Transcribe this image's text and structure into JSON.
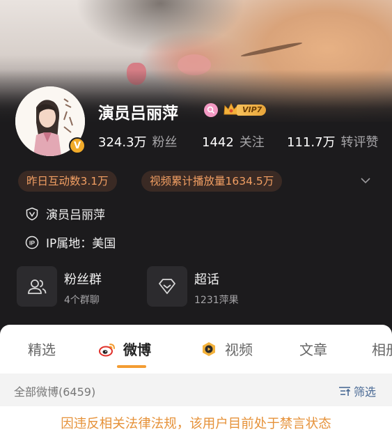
{
  "profile": {
    "name": "演员吕丽萍",
    "vip_label": "VIP7",
    "verified_mark": "V"
  },
  "stats": [
    {
      "num": "324.3万",
      "label": "粉丝"
    },
    {
      "num": "1442",
      "label": "关注"
    },
    {
      "num": "111.7万",
      "label": "转评赞"
    }
  ],
  "chips": {
    "interaction": "昨日互动数3.1万",
    "video_plays": "视频累计播放量1634.5万"
  },
  "info": {
    "certification": "演员吕丽萍",
    "ip_location": "IP属地：美国"
  },
  "cards": [
    {
      "title": "粉丝群",
      "subtitle": "4个群聊"
    },
    {
      "title": "超话",
      "subtitle": "1231萍果"
    }
  ],
  "tabs": [
    {
      "label": "精选"
    },
    {
      "label": "微博"
    },
    {
      "label": "视频"
    },
    {
      "label": "文章"
    },
    {
      "label": "相册"
    }
  ],
  "feed": {
    "count_label": "全部微博(6459)",
    "filter_label": "筛选",
    "notice": "因违反相关法律法规，该用户目前处于禁言状态"
  },
  "colors": {
    "accent_orange": "#f39c32",
    "chip_text": "#f29f63",
    "notice": "#e6923a",
    "filter_blue": "#4a6a95"
  },
  "icons": [
    "search-icon",
    "crown-icon",
    "shield-v-icon",
    "ip-icon",
    "fans-group-icon",
    "supertopic-icon",
    "weibo-logo-icon",
    "video-icon",
    "filter-icon",
    "chevron-down-icon"
  ]
}
